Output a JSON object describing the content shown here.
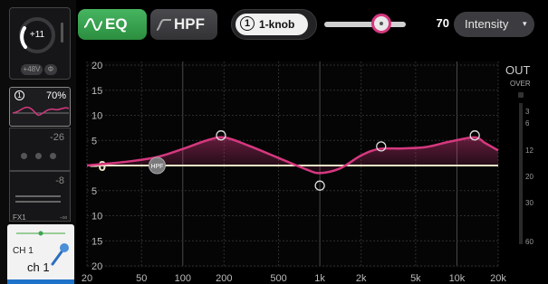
{
  "strip": {
    "gain_value": "+11",
    "phantom_label": "+48V",
    "phase_label": "Φ",
    "eq_thumb_percent": "70%",
    "eq_thumb_icon_text": "1",
    "dynamics_value": "-26",
    "fx_value": "-8",
    "fx_label": "FX1",
    "fx_inf": "-∞",
    "channel_id": "CH 1",
    "channel_name": "ch 1"
  },
  "header": {
    "eq_label": "EQ",
    "hpf_label": "HPF",
    "knob_icon_text": "1",
    "knob_mode_label": "1-knob",
    "intensity_value": "70",
    "intensity_fraction": 0.7,
    "intensity_select_label": "Intensity",
    "intensity_arrow": "▾"
  },
  "colors": {
    "eq_green": "#3aa552",
    "curve_pink": "#d6387f",
    "zero_line": "#f0e6c8",
    "channel_blue": "#1e73c9"
  },
  "graph": {
    "db_ticks_upper": [
      "20",
      "15",
      "10",
      "5"
    ],
    "db_zero_label": "0",
    "db_ticks_lower": [
      "5",
      "10",
      "15",
      "20"
    ],
    "db_tick_values": [
      20,
      15,
      10,
      5,
      0,
      -5,
      -10,
      -15,
      -20
    ],
    "freq_ticks": [
      "20",
      "50",
      "100",
      "200",
      "500",
      "1k",
      "2k",
      "5k",
      "10k",
      "20k"
    ],
    "freq_tick_values": [
      20,
      50,
      100,
      200,
      500,
      1000,
      2000,
      5000,
      10000,
      20000
    ],
    "hpf_marker_label": "HPF",
    "hpf_freq": 65,
    "curve_points_db": [
      [
        20,
        0
      ],
      [
        40,
        0.8
      ],
      [
        65,
        1.7
      ],
      [
        100,
        3.3
      ],
      [
        150,
        5
      ],
      [
        200,
        5.6
      ],
      [
        300,
        4
      ],
      [
        500,
        1.5
      ],
      [
        800,
        -0.8
      ],
      [
        1000,
        -1.5
      ],
      [
        1400,
        -0.6
      ],
      [
        2000,
        2
      ],
      [
        2700,
        3.3
      ],
      [
        4000,
        3.4
      ],
      [
        6000,
        3.7
      ],
      [
        9000,
        4.8
      ],
      [
        13500,
        5.6
      ],
      [
        16000,
        4.5
      ],
      [
        20000,
        3
      ]
    ],
    "band_handles": [
      {
        "freq": 190,
        "db": 6
      },
      {
        "freq": 1000,
        "db": -4
      },
      {
        "freq": 2800,
        "db": 3.8
      },
      {
        "freq": 13500,
        "db": 6
      }
    ]
  },
  "meter": {
    "out_label": "OUT",
    "over_label": "OVER",
    "ticks": [
      "3",
      "6",
      "12",
      "20",
      "30",
      "60"
    ]
  }
}
